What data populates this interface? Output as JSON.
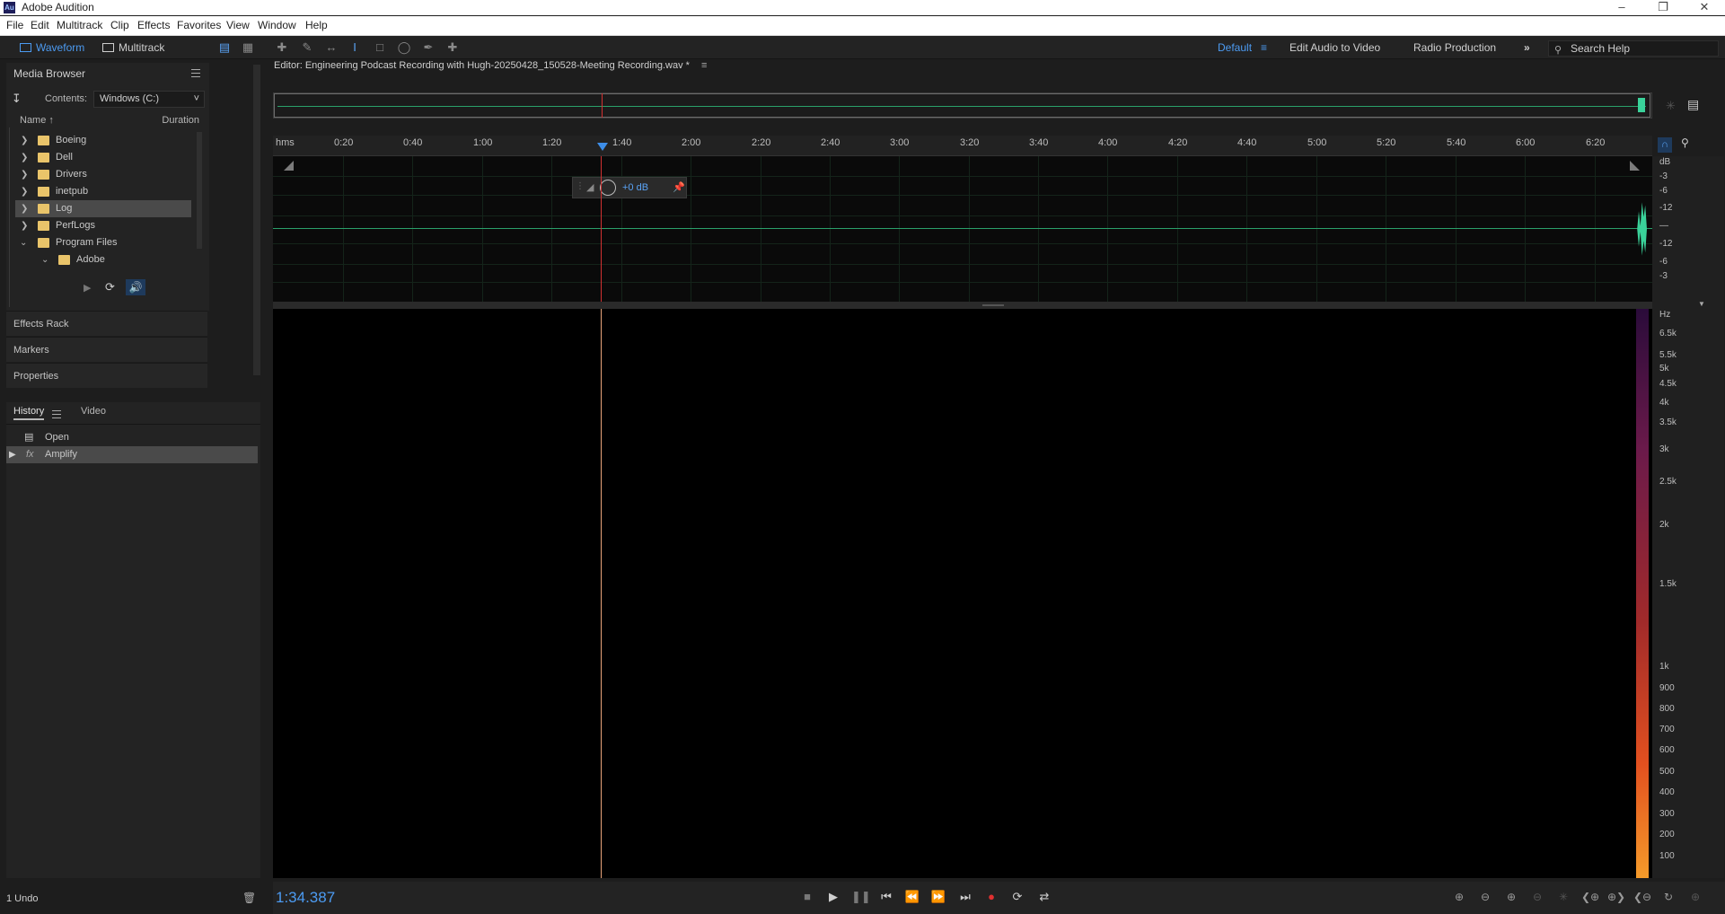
{
  "app": {
    "title": "Adobe Audition",
    "icon": "Au"
  },
  "menu": [
    "File",
    "Edit",
    "Multitrack",
    "Clip",
    "Effects",
    "Favorites",
    "View",
    "Window",
    "Help"
  ],
  "toolbar": {
    "waveform": "Waveform",
    "multitrack": "Multitrack",
    "workspaces": {
      "default": "Default",
      "edit_audio_to_video": "Edit Audio to Video",
      "radio_production": "Radio Production"
    },
    "more": "»",
    "search_placeholder": "Search Help"
  },
  "media_browser": {
    "title": "Media Browser",
    "contents_label": "Contents:",
    "contents_value": "Windows (C:)",
    "col_name": "Name",
    "col_duration": "Duration",
    "items": [
      "Boeing",
      "Dell",
      "Drivers",
      "inetpub",
      "Log",
      "PerfLogs",
      "Program Files",
      "Adobe"
    ]
  },
  "panels": {
    "effects_rack": "Effects Rack",
    "markers": "Markers",
    "properties": "Properties"
  },
  "history": {
    "tab_history": "History",
    "tab_video": "Video",
    "items": [
      {
        "label": "Open"
      },
      {
        "label": "Amplify",
        "icon": "fx"
      }
    ],
    "undo_count": "1 Undo"
  },
  "editor": {
    "title": "Editor: Engineering Podcast Recording with Hugh-20250428_150528-Meeting Recording.wav *",
    "hud_gain": "+0 dB",
    "ruler": [
      "hms",
      "0:20",
      "0:40",
      "1:00",
      "1:20",
      "1:40",
      "2:00",
      "2:20",
      "2:40",
      "3:00",
      "3:20",
      "3:40",
      "4:00",
      "4:20",
      "4:40",
      "5:00",
      "5:20",
      "5:40",
      "6:00",
      "6:20"
    ],
    "db_scale": [
      "dB",
      "-3",
      "-6",
      "-12",
      "—",
      "-12",
      "-6",
      "-3"
    ],
    "hz_scale": [
      "Hz",
      "6.5k",
      "5.5k",
      "5k",
      "4.5k",
      "4k",
      "3.5k",
      "3k",
      "2.5k",
      "2k",
      "1.5k",
      "1k",
      "900",
      "800",
      "700",
      "600",
      "500",
      "400",
      "300",
      "200",
      "100"
    ]
  },
  "transport": {
    "time": "1:34.387"
  }
}
